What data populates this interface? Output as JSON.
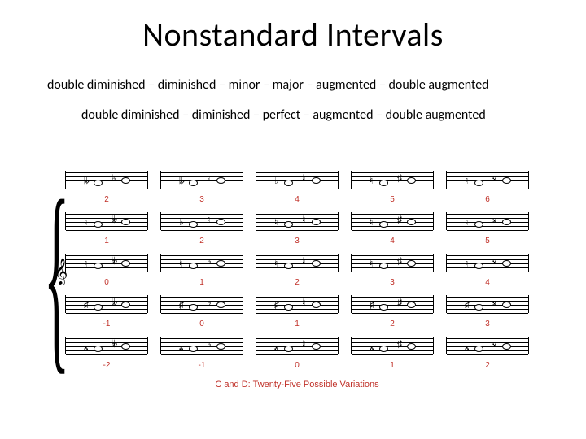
{
  "title": "Nonstandard Intervals",
  "line1": "double diminished – diminished – minor – major – augmented – double augmented",
  "line2": "double diminished – diminished – perfect – augmented – double augmented",
  "rows": [
    {
      "numbers": [
        "2",
        "3",
        "4",
        "5",
        "6"
      ]
    },
    {
      "numbers": [
        "1",
        "2",
        "3",
        "4",
        "5"
      ]
    },
    {
      "numbers": [
        "0",
        "1",
        "2",
        "3",
        "4"
      ]
    },
    {
      "numbers": [
        "-1",
        "0",
        "1",
        "2",
        "3"
      ]
    },
    {
      "numbers": [
        "-2",
        "-1",
        "0",
        "1",
        "2"
      ]
    }
  ],
  "cell_accidentals": {
    "row_top": [
      [
        "𝄫",
        "♭"
      ],
      [
        "𝄫",
        "♮"
      ],
      [
        "♭",
        "♮"
      ],
      [
        "♮",
        "♯"
      ],
      [
        "♮",
        "𝄪"
      ]
    ],
    "row_mid1": [
      [
        "♮",
        "𝄫"
      ],
      [
        "♭",
        "♮"
      ],
      [
        "♮",
        "♮"
      ],
      [
        "♮",
        "♯"
      ],
      [
        "♮",
        "𝄪"
      ]
    ],
    "row_mid2": [
      [
        "♮",
        "𝄫"
      ],
      [
        "♮",
        "♭"
      ],
      [
        "♮",
        "♮"
      ],
      [
        "♮",
        "♯"
      ],
      [
        "♮",
        "𝄪"
      ]
    ],
    "row_mid3": [
      [
        "♯",
        "𝄫"
      ],
      [
        "♯",
        "♭"
      ],
      [
        "♯",
        "♮"
      ],
      [
        "♯",
        "♯"
      ],
      [
        "♯",
        "𝄪"
      ]
    ],
    "row_bot": [
      [
        "𝄪",
        "𝄫"
      ],
      [
        "𝄪",
        "♭"
      ],
      [
        "𝄪",
        "♮"
      ],
      [
        "𝄪",
        "♯"
      ],
      [
        "𝄪",
        "𝄪"
      ]
    ]
  },
  "caption": "C and D: Twenty-Five Possible Variations",
  "clef_glyph": "𝄞"
}
